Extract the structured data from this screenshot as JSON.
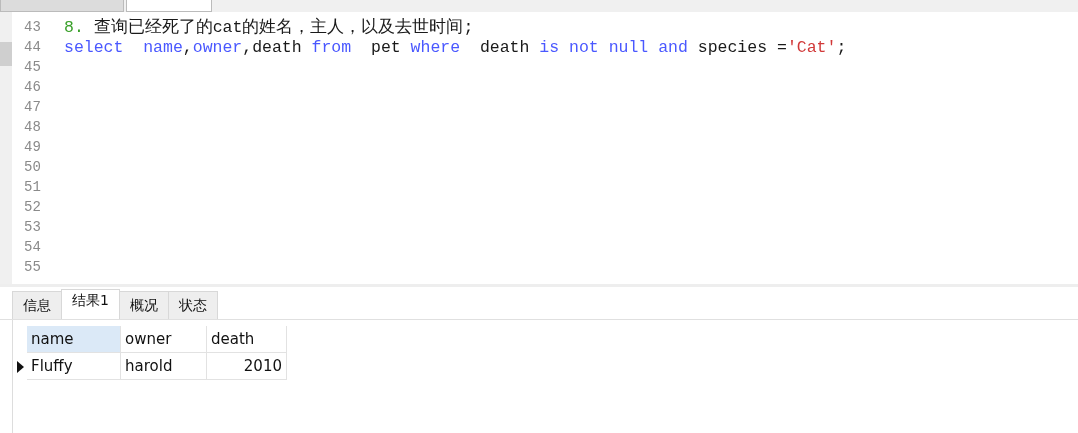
{
  "editor": {
    "lines": [
      {
        "number": "43",
        "tokens": [
          {
            "text": "8.",
            "kind": "number"
          },
          {
            "text": " 查询已经死了的cat的姓名，主人，以及去世时间;",
            "kind": "plain"
          }
        ]
      },
      {
        "number": "44",
        "tokens": [
          {
            "text": "select  name",
            "kind": "keyword"
          },
          {
            "text": ",",
            "kind": "plain"
          },
          {
            "text": "owner",
            "kind": "keyword"
          },
          {
            "text": ",death ",
            "kind": "plain"
          },
          {
            "text": "from",
            "kind": "keyword"
          },
          {
            "text": "  pet ",
            "kind": "plain"
          },
          {
            "text": "where",
            "kind": "keyword"
          },
          {
            "text": "  death ",
            "kind": "plain"
          },
          {
            "text": "is not null and",
            "kind": "keyword"
          },
          {
            "text": " species =",
            "kind": "plain"
          },
          {
            "text": "'Cat'",
            "kind": "string"
          },
          {
            "text": ";",
            "kind": "plain"
          }
        ]
      },
      {
        "number": "45"
      },
      {
        "number": "46"
      },
      {
        "number": "47"
      },
      {
        "number": "48"
      },
      {
        "number": "49"
      },
      {
        "number": "50"
      },
      {
        "number": "51"
      },
      {
        "number": "52"
      },
      {
        "number": "53"
      },
      {
        "number": "54"
      },
      {
        "number": "55"
      }
    ]
  },
  "result_tabs": [
    {
      "label": "信息",
      "selected": false
    },
    {
      "label": "结果1",
      "selected": true
    },
    {
      "label": "概况",
      "selected": false
    },
    {
      "label": "状态",
      "selected": false
    }
  ],
  "grid": {
    "columns": [
      {
        "label": "name",
        "selected": true,
        "kind": "text"
      },
      {
        "label": "owner",
        "selected": false,
        "kind": "text"
      },
      {
        "label": "death",
        "selected": false,
        "kind": "number"
      }
    ],
    "rows": [
      {
        "current": true,
        "cells": [
          "Fluffy",
          "harold",
          "2010"
        ]
      }
    ]
  }
}
